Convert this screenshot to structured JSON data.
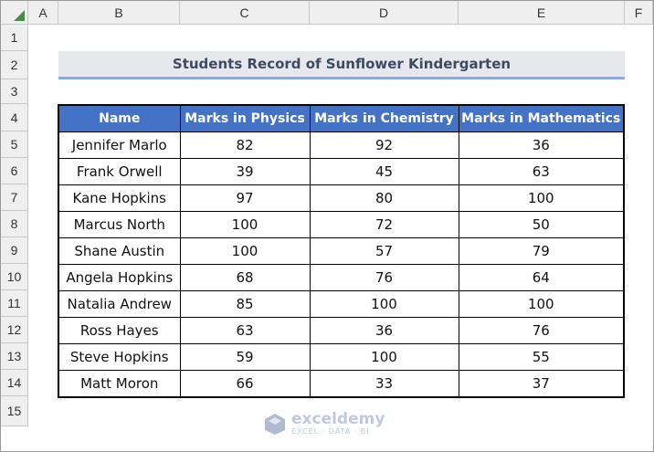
{
  "columns": [
    "A",
    "B",
    "C",
    "D",
    "E",
    "F"
  ],
  "rows": [
    "1",
    "2",
    "3",
    "4",
    "5",
    "6",
    "7",
    "8",
    "9",
    "10",
    "11",
    "12",
    "13",
    "14",
    "15"
  ],
  "title": "Students Record of Sunflower Kindergarten",
  "table": {
    "headers": [
      "Name",
      "Marks in Physics",
      "Marks in Chemistry",
      "Marks in Mathematics"
    ],
    "rows": [
      [
        "Jennifer Marlo",
        "82",
        "92",
        "36"
      ],
      [
        "Frank Orwell",
        "39",
        "45",
        "63"
      ],
      [
        "Kane Hopkins",
        "97",
        "80",
        "100"
      ],
      [
        "Marcus North",
        "100",
        "72",
        "50"
      ],
      [
        "Shane Austin",
        "100",
        "57",
        "79"
      ],
      [
        "Angela Hopkins",
        "68",
        "76",
        "64"
      ],
      [
        "Natalia Andrew",
        "85",
        "100",
        "100"
      ],
      [
        "Ross Hayes",
        "63",
        "36",
        "76"
      ],
      [
        "Steve Hopkins",
        "59",
        "100",
        "55"
      ],
      [
        "Matt Moron",
        "66",
        "33",
        "37"
      ]
    ]
  },
  "watermark": {
    "name": "exceldemy",
    "tagline": "EXCEL · DATA · BI"
  },
  "colors": {
    "header_fill": "#4472c4",
    "title_fill": "#e6e8ee",
    "title_underline": "#8ea9db"
  }
}
